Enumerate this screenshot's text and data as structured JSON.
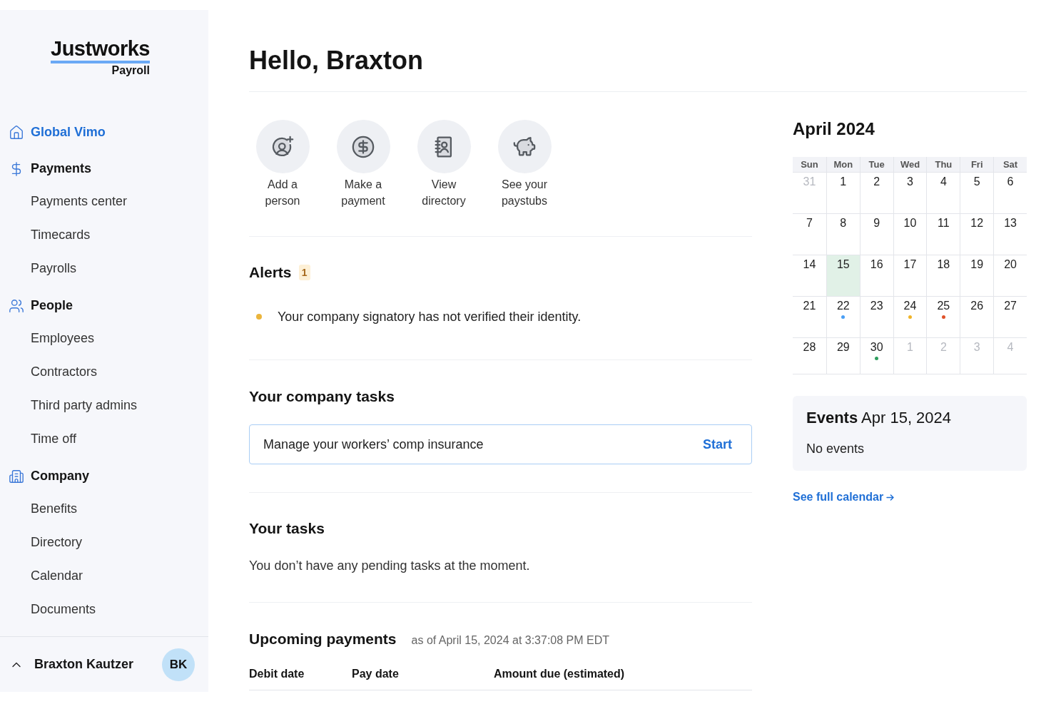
{
  "sidebar": {
    "logo": {
      "wordmark": "Justworks",
      "product": "Payroll"
    },
    "nav": [
      {
        "label": "Global Vimo",
        "selected": true
      },
      {
        "label": "Payments",
        "selected": false,
        "children": [
          {
            "label": "Payments center",
            "selected": false
          },
          {
            "label": "Timecards",
            "selected": false
          },
          {
            "label": "Payrolls",
            "selected": false
          }
        ]
      },
      {
        "label": "People",
        "selected": false,
        "children": [
          {
            "label": "Employees",
            "selected": false
          },
          {
            "label": "Contractors",
            "selected": false
          },
          {
            "label": "Third party admins",
            "selected": false
          },
          {
            "label": "Time off",
            "selected": false
          }
        ]
      },
      {
        "label": "Company",
        "selected": false,
        "children": [
          {
            "label": "Benefits",
            "selected": false
          },
          {
            "label": "Directory",
            "selected": false
          },
          {
            "label": "Calendar",
            "selected": false
          },
          {
            "label": "Documents",
            "selected": false
          }
        ]
      }
    ],
    "user": {
      "name": "Braxton Kautzer",
      "initials": "BK"
    }
  },
  "main": {
    "greeting": "Hello, Braxton",
    "quick_actions": [
      {
        "label": "Add a person"
      },
      {
        "label": "Make a payment"
      },
      {
        "label": "View directory"
      },
      {
        "label": "See your paystubs"
      }
    ],
    "alerts": {
      "title": "Alerts",
      "count": "1",
      "items": [
        {
          "text": "Your company signatory has not verified their identity."
        }
      ]
    },
    "company_tasks": {
      "title": "Your company tasks",
      "items": [
        {
          "text": "Manage your workers’ comp insurance",
          "action": "Start"
        }
      ]
    },
    "your_tasks": {
      "title": "Your tasks",
      "empty_text": "You don’t have any pending tasks at the moment."
    },
    "upcoming_payments": {
      "title": "Upcoming payments",
      "as_of": "as of April 15, 2024 at 3:37:08 PM EDT",
      "columns": [
        "Debit date",
        "Pay date",
        "Amount due (estimated)"
      ]
    }
  },
  "calendar": {
    "title": "April 2024",
    "weekdays": [
      "Sun",
      "Mon",
      "Tue",
      "Wed",
      "Thu",
      "Fri",
      "Sat"
    ],
    "weeks": [
      [
        {
          "day": "31",
          "outside": true,
          "selected": false
        },
        {
          "day": "1",
          "outside": false,
          "selected": false
        },
        {
          "day": "2",
          "outside": false,
          "selected": false
        },
        {
          "day": "3",
          "outside": false,
          "selected": false
        },
        {
          "day": "4",
          "outside": false,
          "selected": false
        },
        {
          "day": "5",
          "outside": false,
          "selected": false
        },
        {
          "day": "6",
          "outside": false,
          "selected": false
        }
      ],
      [
        {
          "day": "7",
          "outside": false,
          "selected": false
        },
        {
          "day": "8",
          "outside": false,
          "selected": false
        },
        {
          "day": "9",
          "outside": false,
          "selected": false
        },
        {
          "day": "10",
          "outside": false,
          "selected": false
        },
        {
          "day": "11",
          "outside": false,
          "selected": false
        },
        {
          "day": "12",
          "outside": false,
          "selected": false
        },
        {
          "day": "13",
          "outside": false,
          "selected": false
        }
      ],
      [
        {
          "day": "14",
          "outside": false,
          "selected": false
        },
        {
          "day": "15",
          "outside": false,
          "selected": true
        },
        {
          "day": "16",
          "outside": false,
          "selected": false
        },
        {
          "day": "17",
          "outside": false,
          "selected": false
        },
        {
          "day": "18",
          "outside": false,
          "selected": false
        },
        {
          "day": "19",
          "outside": false,
          "selected": false
        },
        {
          "day": "20",
          "outside": false,
          "selected": false
        }
      ],
      [
        {
          "day": "21",
          "outside": false,
          "selected": false
        },
        {
          "day": "22",
          "outside": false,
          "selected": false,
          "color": "#4a9ff5"
        },
        {
          "day": "23",
          "outside": false,
          "selected": false
        },
        {
          "day": "24",
          "outside": false,
          "selected": false,
          "color": "#f0b429"
        },
        {
          "day": "25",
          "outside": false,
          "selected": false,
          "color": "#e0522a"
        },
        {
          "day": "26",
          "outside": false,
          "selected": false
        },
        {
          "day": "27",
          "outside": false,
          "selected": false
        }
      ],
      [
        {
          "day": "28",
          "outside": false,
          "selected": false
        },
        {
          "day": "29",
          "outside": false,
          "selected": false
        },
        {
          "day": "30",
          "outside": false,
          "selected": false,
          "color": "#2e9e5e"
        },
        {
          "day": "1",
          "outside": true,
          "selected": false
        },
        {
          "day": "2",
          "outside": true,
          "selected": false
        },
        {
          "day": "3",
          "outside": true,
          "selected": false
        },
        {
          "day": "4",
          "outside": true,
          "selected": false
        }
      ]
    ],
    "events": {
      "title": "Events",
      "date": "Apr 15, 2024",
      "empty_text": "No events"
    },
    "link": "See full calendar"
  }
}
